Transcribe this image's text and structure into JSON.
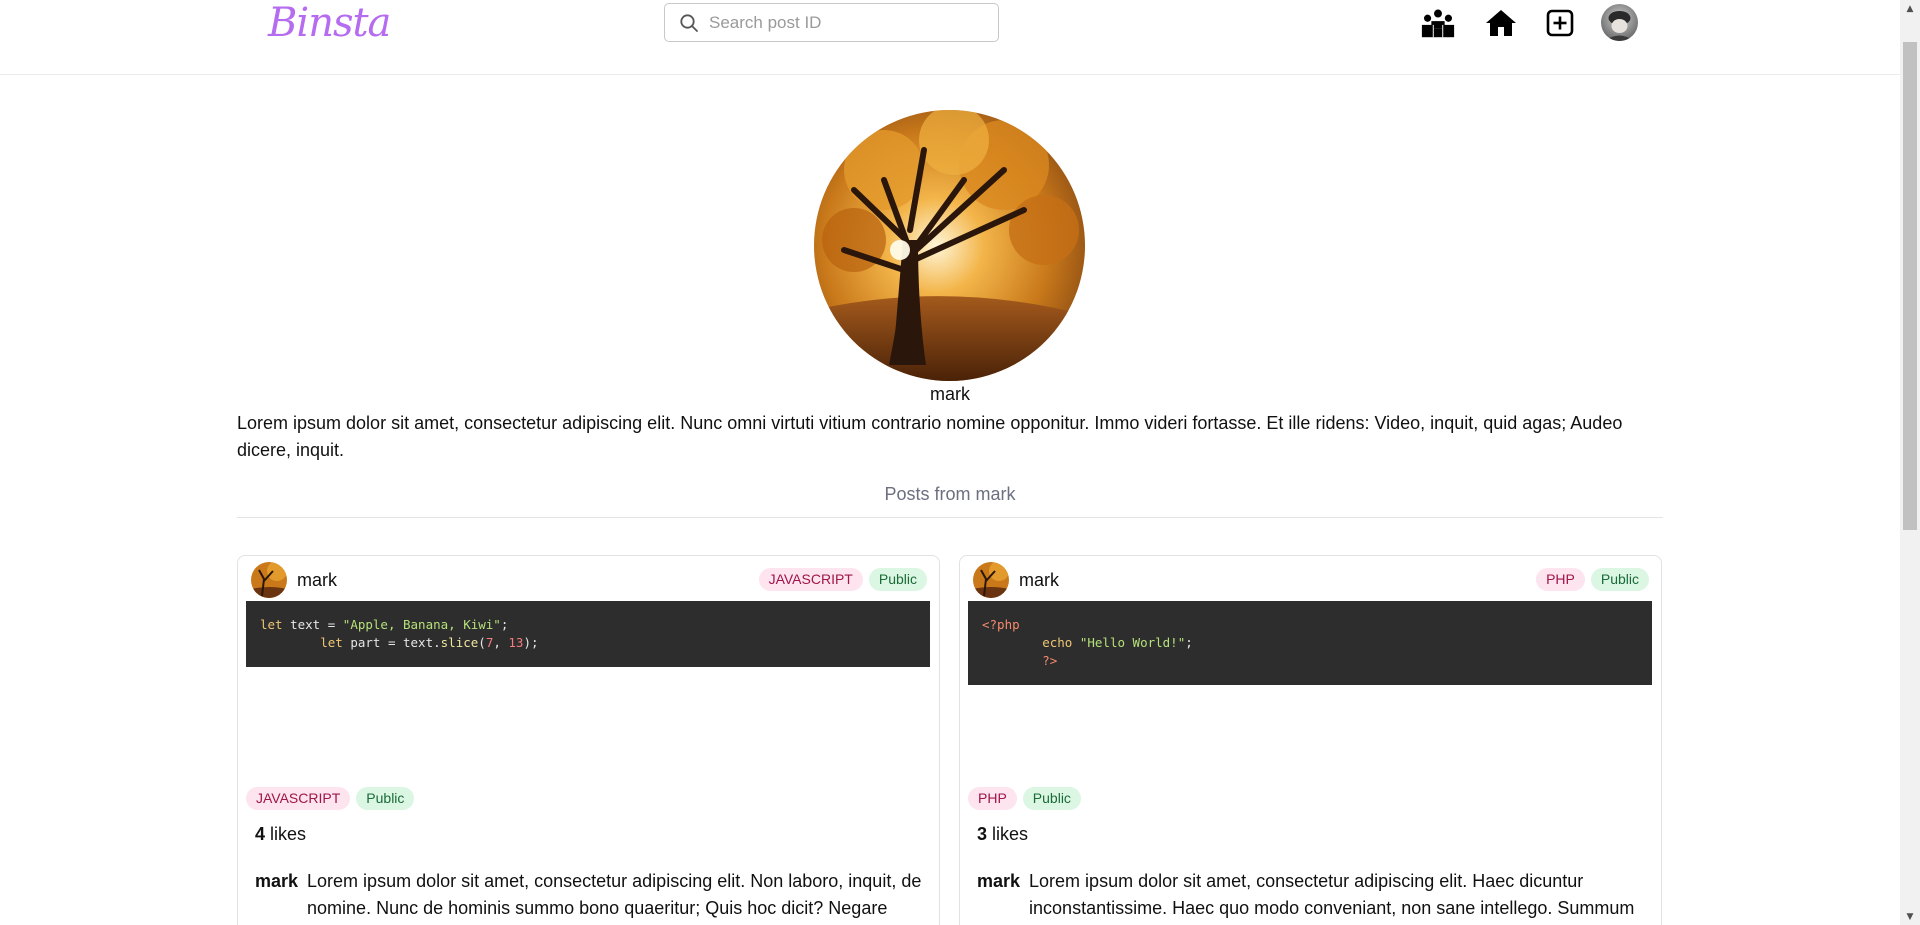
{
  "header": {
    "logo": "Binsta",
    "search": {
      "placeholder": "Search post ID",
      "value": ""
    },
    "nav_icons": [
      "users-icon",
      "home-icon",
      "add-post-icon",
      "user-avatar"
    ]
  },
  "profile": {
    "username": "mark",
    "bio": "Lorem ipsum dolor sit amet, consectetur adipiscing elit. Nunc omni virtuti vitium contrario nomine opponitur. Immo videri fortasse. Et ille ridens: Video, inquit, quid agas; Audeo dicere, inquit.",
    "posts_heading": "Posts from mark"
  },
  "posts": [
    {
      "user": "mark",
      "language": "JAVASCRIPT",
      "visibility": "Public",
      "code_lines": [
        "let text = \"Apple, Banana, Kiwi\";",
        "        let part = text.slice(7, 13);"
      ],
      "likes_count": "4",
      "likes_label": "likes",
      "caption": "Lorem ipsum dolor sit amet, consectetur adipiscing elit. Non laboro, inquit, de nomine. Nunc de hominis summo bono quaeritur; Quis hoc dicit? Negare"
    },
    {
      "user": "mark",
      "language": "PHP",
      "visibility": "Public",
      "code_lines": [
        "<?php",
        "        echo \"Hello World!\";",
        "        ?>"
      ],
      "likes_count": "3",
      "likes_label": "likes",
      "caption": "Lorem ipsum dolor sit amet, consectetur adipiscing elit. Haec dicuntur inconstantissime. Haec quo modo conveniant, non sane intellego. Summum"
    }
  ],
  "colors": {
    "logo": "#b56cf0",
    "code_bg": "#2d2d2d",
    "tag_lang_bg": "#fde4ee",
    "tag_public_bg": "#dcf6e4"
  }
}
